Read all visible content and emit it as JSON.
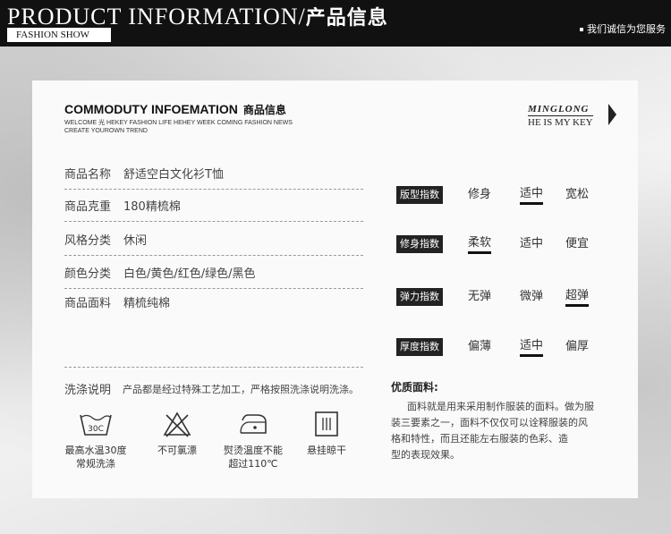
{
  "header": {
    "title_en": "PRODUCT INFORMATION/",
    "title_cn": "产品信息",
    "subtitle": "FASHION SHOW",
    "right_text": "我们诚信为您服务"
  },
  "brand": {
    "title": "COMMODUTY INFOEMATION",
    "title_cn": "商品信息",
    "sub1": "WELCOME 光 HEKEY FASHION LIFE HEHEY WEEK COMING FASHION NEWS",
    "sub2": "CREATE YOUROWN TREND"
  },
  "logo": {
    "line1": "MINGLONG",
    "line2": "HE IS MY KEY"
  },
  "info": [
    {
      "label": "商品名称",
      "value": "舒适空白文化衫T恤"
    },
    {
      "label": "商品克重",
      "value": "180精梳棉"
    },
    {
      "label": "风格分类",
      "value": "休闲"
    },
    {
      "label": "颜色分类",
      "value": "白色/黄色/红色/绿色/黑色"
    },
    {
      "label": "商品面料",
      "value": "精梳纯棉"
    }
  ],
  "indices": [
    {
      "tag": "版型指数",
      "options": [
        "修身",
        "适中",
        "宽松"
      ],
      "selected": 1
    },
    {
      "tag": "修身指数",
      "options": [
        "柔软",
        "适中",
        "便宜"
      ],
      "selected": 0
    },
    {
      "tag": "弹力指数",
      "options": [
        "无弹",
        "微弹",
        "超弹"
      ],
      "selected": 2
    },
    {
      "tag": "厚度指数",
      "options": [
        "偏薄",
        "适中",
        "偏厚"
      ],
      "selected": 1
    }
  ],
  "wash": {
    "label": "洗涤说明",
    "desc": "产品都是经过特殊工艺加工，严格按照洗涤说明洗涤。",
    "icon_temp": "30C",
    "care": [
      {
        "icon": "wash-tub-icon",
        "line1": "最高水温30度",
        "line2": "常规洗涤"
      },
      {
        "icon": "no-bleach-icon",
        "line1": "不可氯漂",
        "line2": ""
      },
      {
        "icon": "iron-icon",
        "line1": "熨烫温度不能",
        "line2": "超过110℃"
      },
      {
        "icon": "hang-dry-icon",
        "line1": "悬挂晾干",
        "line2": ""
      }
    ]
  },
  "fabric": {
    "title": "优质面料:",
    "body": "面料就是用来采用制作服装的面料。做为服装三要素之一，面料不仅仅可以诠释服装的风格和特性，而且还能左右服装的色彩、造型的表现效果。",
    "lines": [
      "面料就是用来采用制作服装的面料。做为服",
      "装三要素之一，面料不仅仅可以诠释服装的风",
      "格和特性，而且还能左右服装的色彩、造",
      "型的表现效果。"
    ]
  }
}
